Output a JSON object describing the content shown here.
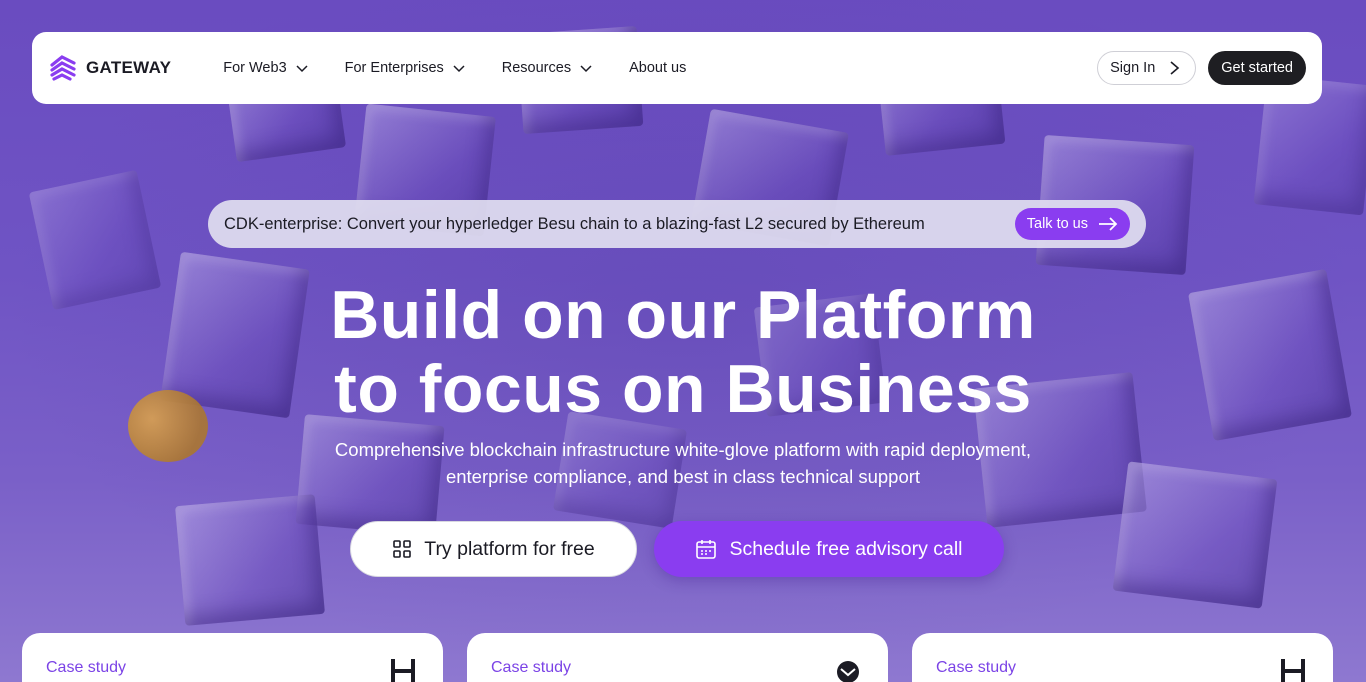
{
  "brand": {
    "name": "GATEWAY",
    "accent": "#8a3df0",
    "logo_icon": "gateway-stripes-logo"
  },
  "nav": {
    "items": [
      {
        "label": "For Web3",
        "has_dropdown": true
      },
      {
        "label": "For Enterprises",
        "has_dropdown": true
      },
      {
        "label": "Resources",
        "has_dropdown": true
      },
      {
        "label": "About us",
        "has_dropdown": false
      }
    ],
    "sign_in": "Sign In",
    "get_started": "Get started"
  },
  "announcement": {
    "text": "CDK-enterprise: Convert your hyperledger Besu chain to a blazing-fast L2 secured by Ethereum",
    "cta": "Talk to us"
  },
  "hero": {
    "title_line1": "Build on our Platform",
    "title_line2": "to focus on Business",
    "subtitle_line1": "Comprehensive blockchain infrastructure white-glove platform with rapid deployment,",
    "subtitle_line2": "enterprise compliance, and best in class technical support",
    "cta_primary": "Try platform for free",
    "cta_secondary": "Schedule free advisory call"
  },
  "cards": [
    {
      "label": "Case study",
      "logo_icon": "h-brand-logo"
    },
    {
      "label": "Case study",
      "logo_icon": "round-brand-logo"
    },
    {
      "label": "Case study",
      "logo_icon": "h-brand-logo"
    }
  ]
}
